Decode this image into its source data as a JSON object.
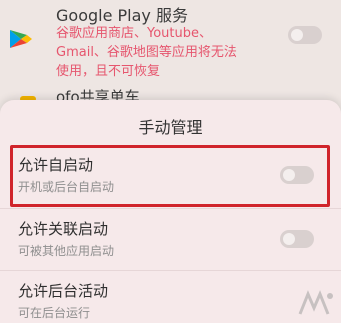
{
  "background_list": {
    "app_name": "Google Play 服务",
    "app_desc_line1": "谷歌应用商店、Youtube、",
    "app_desc_line2": "Gmail、谷歌地图等应用将无法",
    "app_desc_line3": "使用，且不可恢复",
    "next_app_name": "ofo共享单车"
  },
  "dialog": {
    "title": "手动管理",
    "options": [
      {
        "label": "允许自启动",
        "desc": "开机或后台自启动",
        "enabled": false
      },
      {
        "label": "允许关联启动",
        "desc": "可被其他应用启动",
        "enabled": false
      },
      {
        "label": "允许后台活动",
        "desc": "可在后台运行",
        "enabled": false
      }
    ]
  },
  "colors": {
    "warning_text": "#e6566e",
    "highlight_box": "#d0242b",
    "sheet_bg": "#f6e9ea"
  },
  "icons": {
    "app_icon": "google-play-services-icon",
    "watermark": "watermark-logo-icon"
  }
}
